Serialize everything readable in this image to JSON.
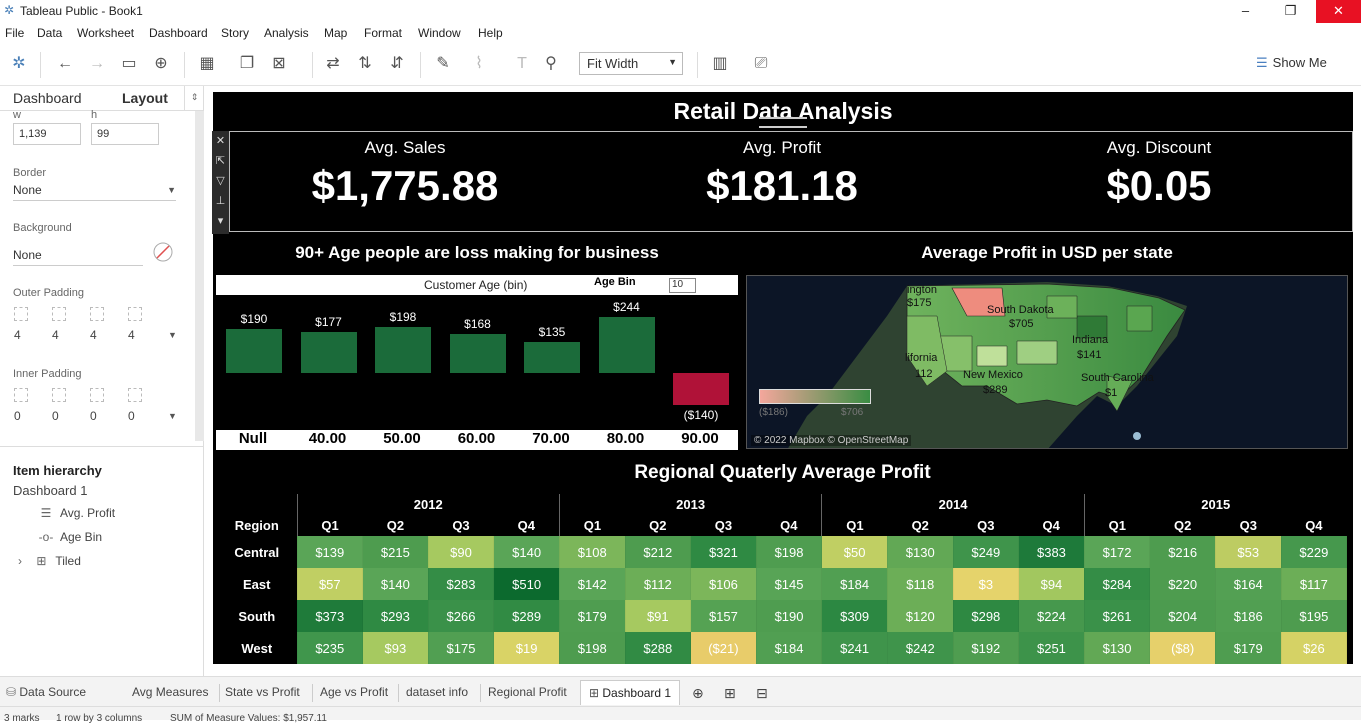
{
  "window": {
    "title": "Tableau Public - Book1"
  },
  "menu": [
    "File",
    "Data",
    "Worksheet",
    "Dashboard",
    "Story",
    "Analysis",
    "Map",
    "Format",
    "Window",
    "Help"
  ],
  "toolbar": {
    "fit_label": "Fit Width",
    "show_me_label": "Show Me"
  },
  "left_panel": {
    "tab_dashboard": "Dashboard",
    "tab_layout": "Layout",
    "w_label": "w",
    "w_value": "1,139",
    "h_label": "h",
    "h_value": "99",
    "border_label": "Border",
    "border_value": "None",
    "background_label": "Background",
    "background_value": "None",
    "outer_padding_label": "Outer Padding",
    "outer_padding_values": [
      "4",
      "4",
      "4",
      "4"
    ],
    "inner_padding_label": "Inner Padding",
    "inner_padding_values": [
      "0",
      "0",
      "0",
      "0"
    ],
    "hierarchy_title": "Item hierarchy",
    "hierarchy_root": "Dashboard 1",
    "hierarchy_items": [
      "Avg. Profit",
      "Age Bin",
      "Tiled"
    ]
  },
  "dashboard": {
    "title": "Retail Data Analysis",
    "kpis": [
      {
        "label": "Avg. Sales",
        "value": "$1,775.88"
      },
      {
        "label": "Avg. Profit",
        "value": "$181.18"
      },
      {
        "label": "Avg. Discount",
        "value": "$0.05"
      }
    ],
    "age_panel": {
      "title": "90+ Age people are loss making for business",
      "header": "Customer Age (bin)",
      "param_label": "Age Bin",
      "param_value": "10",
      "bins": [
        "Null",
        "40.00",
        "50.00",
        "60.00",
        "70.00",
        "80.00",
        "90.00"
      ],
      "labels": [
        "$190",
        "$177",
        "$198",
        "$168",
        "$135",
        "$244",
        "($140)"
      ],
      "values": [
        190,
        177,
        198,
        168,
        135,
        244,
        -140
      ]
    },
    "map_panel": {
      "title": "Average Profit in USD per state",
      "credit": "© 2022 Mapbox © OpenStreetMap",
      "labels": [
        "ington",
        "$175",
        "South Dakota",
        "$705",
        "Indiana",
        "$141",
        "lifornia",
        "112",
        "New Mexico",
        "$289",
        "South Carolina",
        "$1",
        "($186)",
        "$706"
      ]
    },
    "regional": {
      "title": "Regional Quaterly Average Profit",
      "region_header": "Region",
      "years": [
        "2012",
        "2013",
        "2014",
        "2015"
      ],
      "quarters": [
        "Q1",
        "Q2",
        "Q3",
        "Q4"
      ],
      "rows": [
        {
          "region": "Central",
          "cells": [
            "$139",
            "$215",
            "$90",
            "$140",
            "$108",
            "$212",
            "$321",
            "$198",
            "$50",
            "$130",
            "$249",
            "$383",
            "$172",
            "$216",
            "$53",
            "$229"
          ],
          "colors": [
            "#5aa557",
            "#4e9c4f",
            "#a6c960",
            "#5aa557",
            "#7cb65a",
            "#4e9c4f",
            "#2f8a43",
            "#4f9d50",
            "#c0cf63",
            "#62a855",
            "#3f944b",
            "#1e7a3a",
            "#5aa557",
            "#4e9c4f",
            "#bdcc62",
            "#46984d"
          ]
        },
        {
          "region": "East",
          "cells": [
            "$57",
            "$140",
            "$283",
            "$510",
            "$142",
            "$112",
            "$106",
            "$145",
            "$184",
            "$118",
            "$3",
            "$94",
            "$284",
            "$220",
            "$164",
            "$117"
          ],
          "colors": [
            "#c0cf63",
            "#5aa557",
            "#348d46",
            "#0c6a2e",
            "#5aa557",
            "#6cae57",
            "#7cb65a",
            "#58a456",
            "#519f52",
            "#6cae57",
            "#e5d36b",
            "#a2c75f",
            "#348d46",
            "#4e9c4f",
            "#53a053",
            "#6cae57"
          ]
        },
        {
          "region": "South",
          "cells": [
            "$373",
            "$293",
            "$266",
            "$289",
            "$179",
            "$91",
            "$157",
            "$190",
            "$309",
            "$120",
            "$298",
            "$224",
            "$261",
            "$204",
            "$186",
            "$195"
          ],
          "colors": [
            "#1f7b3a",
            "#2f8a43",
            "#3a9149",
            "#318b44",
            "#4f9d50",
            "#a6c960",
            "#55a253",
            "#4f9d50",
            "#2c8842",
            "#6cae57",
            "#2e8942",
            "#46984d",
            "#3a9149",
            "#4c9b4f",
            "#519f52",
            "#4e9c4f"
          ]
        },
        {
          "region": "West",
          "cells": [
            "$235",
            "$93",
            "$175",
            "$19",
            "$198",
            "$288",
            "($21)",
            "$184",
            "$241",
            "$242",
            "$192",
            "$251",
            "$130",
            "($8)",
            "$179",
            "$26"
          ],
          "colors": [
            "#40964c",
            "#a6c960",
            "#519f52",
            "#d9d366",
            "#4e9c4f",
            "#318b44",
            "#e8cc6a",
            "#519f52",
            "#3f944b",
            "#3f944b",
            "#4f9d50",
            "#3d934a",
            "#62a855",
            "#e6d06b",
            "#4f9d50",
            "#d5d265"
          ]
        }
      ]
    }
  },
  "sheet_tabs": [
    "Data Source",
    "Avg Measures",
    "State vs Profit",
    "Age vs Profit",
    "dataset info",
    "Regional Profit",
    "Dashboard 1"
  ],
  "status": {
    "marks": "3 marks",
    "rows": "1 row by 3 columns",
    "sum": "SUM of Measure Values: $1,957.11"
  },
  "colors": {
    "bar_positive": "#1b6b3a",
    "bar_negative": "#b01238",
    "close_button": "#e81123"
  }
}
